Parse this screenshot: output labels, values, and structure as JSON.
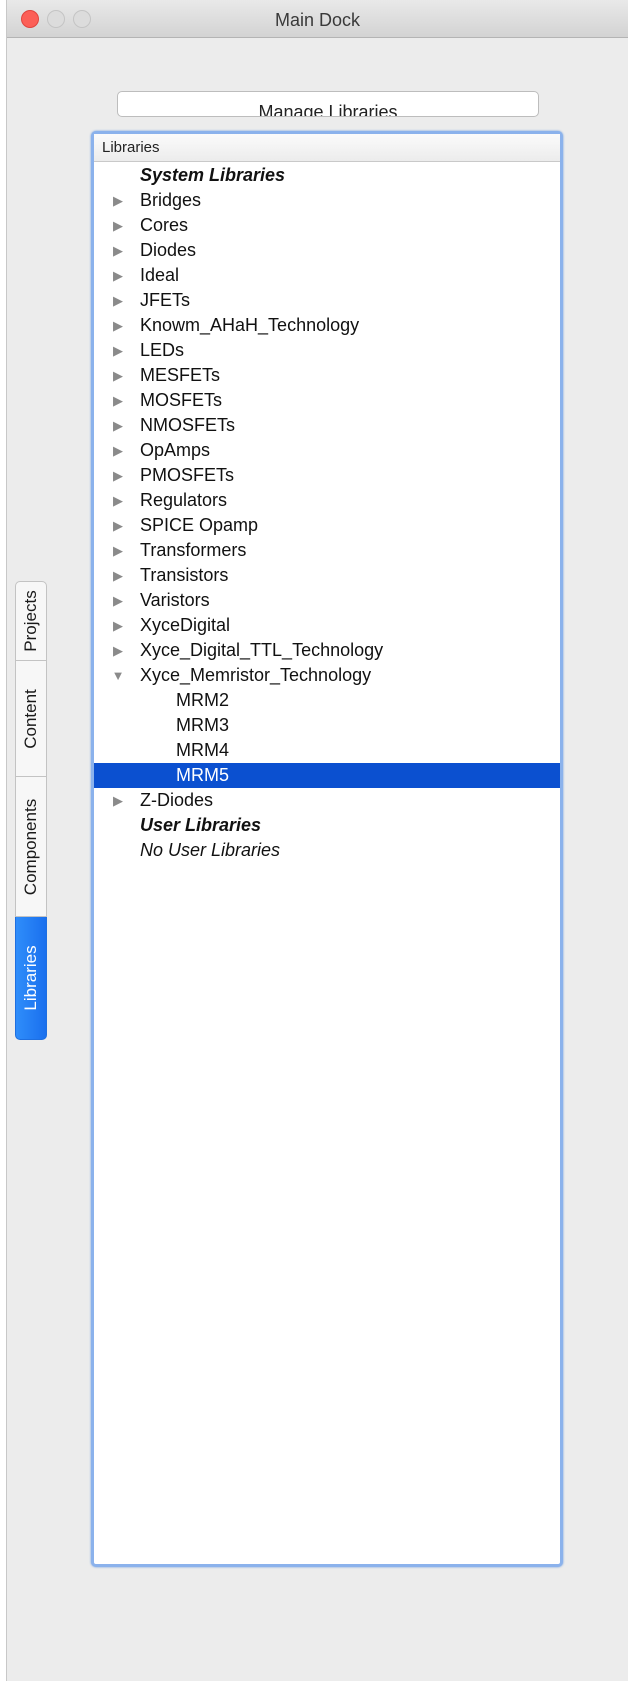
{
  "window": {
    "title": "Main Dock"
  },
  "toolbar": {
    "manage_label": "Manage Libraries"
  },
  "tabs": [
    {
      "label": "Projects",
      "active": false
    },
    {
      "label": "Content",
      "active": false
    },
    {
      "label": "Components",
      "active": false
    },
    {
      "label": "Libraries",
      "active": true
    }
  ],
  "panel": {
    "header": "Libraries"
  },
  "tree": {
    "system_header": "System Libraries",
    "items": [
      "Bridges",
      "Cores",
      "Diodes",
      "Ideal",
      "JFETs",
      "Knowm_AHaH_Technology",
      "LEDs",
      "MESFETs",
      "MOSFETs",
      "NMOSFETs",
      "OpAmps",
      "PMOSFETs",
      "Regulators",
      "SPICE Opamp",
      "Transformers",
      "Transistors",
      "Varistors",
      "XyceDigital",
      "Xyce_Digital_TTL_Technology"
    ],
    "expanded": {
      "label": "Xyce_Memristor_Technology",
      "children": [
        "MRM2",
        "MRM3",
        "MRM4",
        "MRM5"
      ],
      "selected": "MRM5"
    },
    "after": [
      "Z-Diodes"
    ],
    "user_header": "User Libraries",
    "user_note": "No User Libraries"
  },
  "icons": {
    "collapsed": "triangle-right-icon",
    "expanded": "triangle-down-icon"
  },
  "colors": {
    "selection": "#0b50d0",
    "active_tab": "#1a70ee",
    "close_button": "#fc5f57",
    "panel_border": "#8bb2ec"
  }
}
